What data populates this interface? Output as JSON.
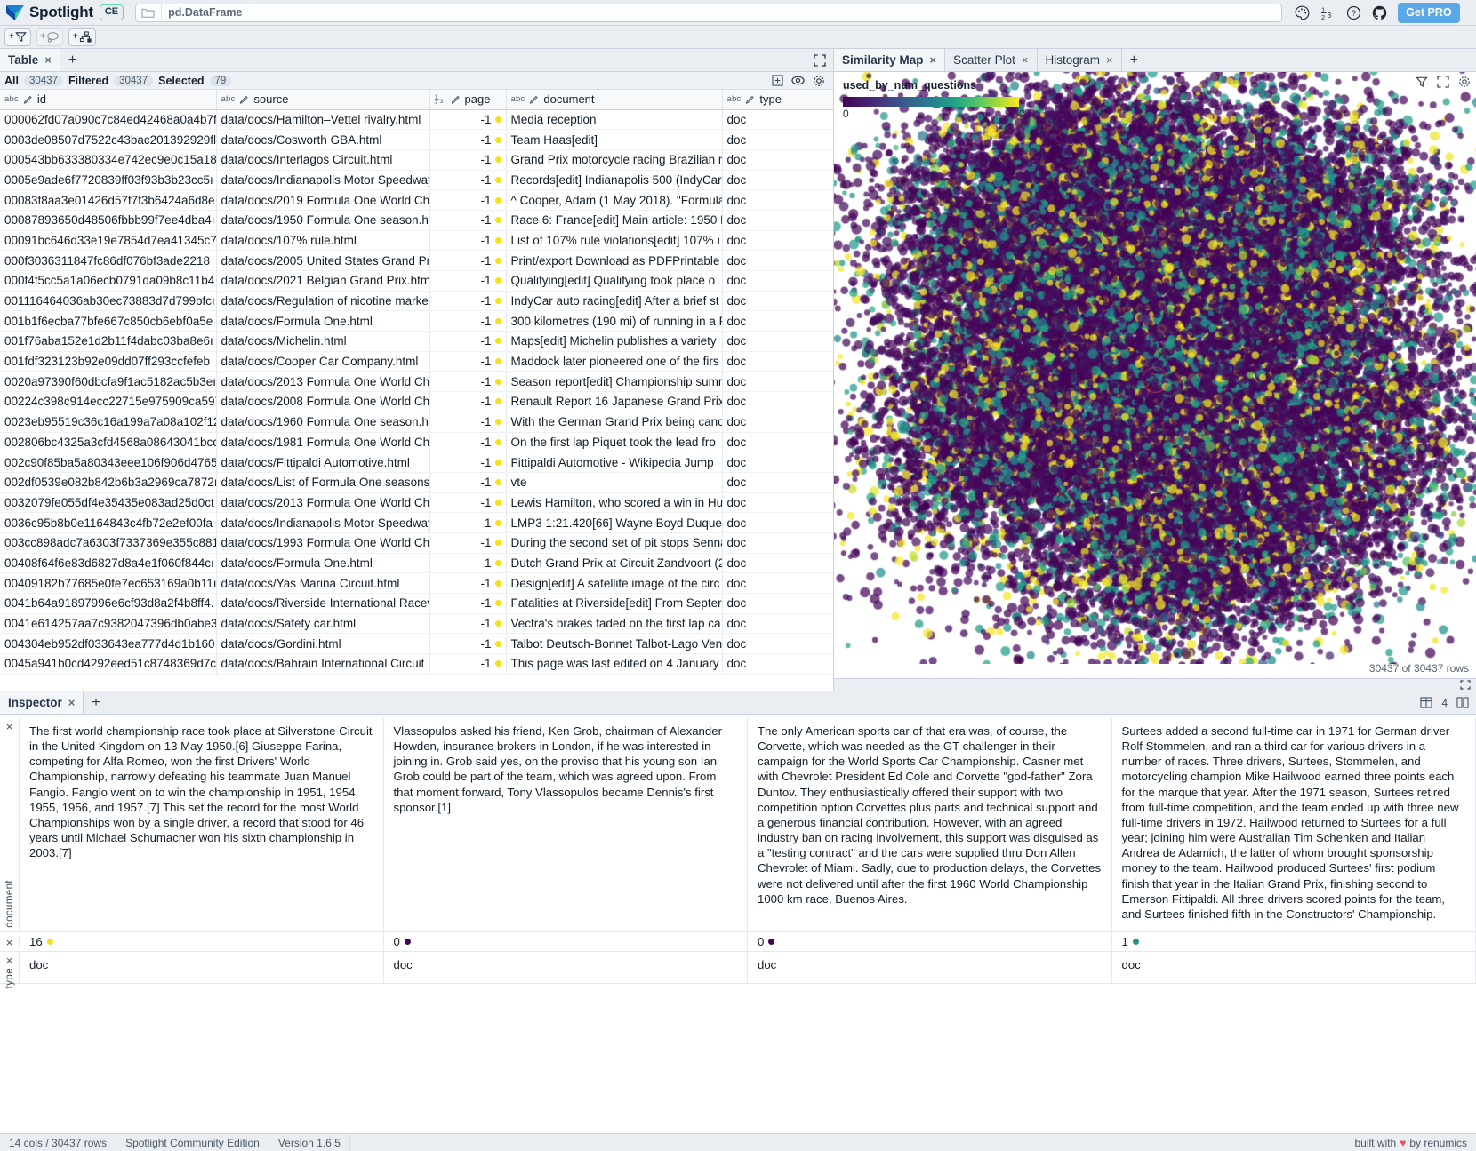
{
  "app": {
    "brand": "Spotlight",
    "edition_badge": "CE",
    "dataframe_label": "pd.DataFrame",
    "get_pro_label": "Get PRO",
    "icons": {
      "folder": "folder-icon",
      "palette": "palette-icon",
      "fraction": "number-format-icon",
      "help": "help-circle-icon",
      "github": "github-icon"
    }
  },
  "toolrow": {
    "add_filter_label": "+",
    "add_filter_icon": "funnel-icon",
    "add_group_icon": "lasso-icon",
    "add_issues_icon": "data-issues-icon"
  },
  "table_panel": {
    "tab_label": "Table",
    "tab_close": "×",
    "tab_add": "+",
    "maximize_icon": "maximize-icon",
    "counts": [
      {
        "label": "All",
        "value": "30437"
      },
      {
        "label": "Filtered",
        "value": "30437"
      },
      {
        "label": "Selected",
        "value": "79"
      }
    ],
    "right_icons": [
      "add-column-icon",
      "visibility-icon",
      "settings-icon"
    ],
    "columns": [
      {
        "name": "id",
        "type": "abc"
      },
      {
        "name": "source",
        "type": "abc"
      },
      {
        "name": "page",
        "type": "123"
      },
      {
        "name": "document",
        "type": "abc"
      },
      {
        "name": "type",
        "type": "abc"
      }
    ],
    "rows": [
      {
        "id": "000062fd07a090c7c84ed42468a0a4b7f",
        "source": "data/docs/Hamilton–Vettel rivalry.html",
        "page": "-1",
        "page_color": "#f5e119",
        "document": "Media reception",
        "type": "doc"
      },
      {
        "id": "0003de08507d7522c43bac201392929fl",
        "source": "data/docs/Cosworth GBA.html",
        "page": "-1",
        "page_color": "#f5e119",
        "document": "Team Haas[edit]",
        "type": "doc"
      },
      {
        "id": "000543bb633380334e742ec9e0c15a18",
        "source": "data/docs/Interlagos Circuit.html",
        "page": "-1",
        "page_color": "#f5e119",
        "document": "Grand Prix motorcycle racing Brazilian m",
        "type": "doc"
      },
      {
        "id": "0005e9ade6f7720839ff03f93b3b23cc5ı",
        "source": "data/docs/Indianapolis Motor Speedway",
        "page": "-1",
        "page_color": "#f5e119",
        "document": "Records[edit] Indianapolis 500 (IndyCar",
        "type": "doc"
      },
      {
        "id": "00083f8aa3e01426d57f7f3b6424a6d8e",
        "source": "data/docs/2019 Formula One World Cha",
        "page": "-1",
        "page_color": "#f5e119",
        "document": "^ Cooper, Adam (1 May 2018). \"Formula",
        "type": "doc"
      },
      {
        "id": "00087893650d48506fbbb99f7ee4dba4ı",
        "source": "data/docs/1950 Formula One season.ht",
        "page": "-1",
        "page_color": "#f5e119",
        "document": "Race 6: France[edit] Main article: 1950 F",
        "type": "doc"
      },
      {
        "id": "00091bc646d33e19e7854d7ea41345c7",
        "source": "data/docs/107% rule.html",
        "page": "-1",
        "page_color": "#f5e119",
        "document": "List of 107% rule violations[edit] 107% ı",
        "type": "doc"
      },
      {
        "id": "000f3036311847fc86df076bf3ade2218",
        "source": "data/docs/2005 United States Grand Pri",
        "page": "-1",
        "page_color": "#f5e119",
        "document": "Print/export Download as PDFPrintable",
        "type": "doc"
      },
      {
        "id": "000f4f5cc5a1a06ecb0791da09b8c11b4",
        "source": "data/docs/2021 Belgian Grand Prix.html",
        "page": "-1",
        "page_color": "#f5e119",
        "document": "Qualifying[edit] Qualifying took place o",
        "type": "doc"
      },
      {
        "id": "001116464036ab30ec73883d7d799bfcı",
        "source": "data/docs/Regulation of nicotine marke",
        "page": "-1",
        "page_color": "#f5e119",
        "document": "IndyCar auto racing[edit] After a brief st",
        "type": "doc"
      },
      {
        "id": "001b1f6ecba77bfe667c850cb6ebf0a5e",
        "source": "data/docs/Formula One.html",
        "page": "-1",
        "page_color": "#f5e119",
        "document": "300 kilometres (190 mi) of running in a F",
        "type": "doc"
      },
      {
        "id": "001f76aba152e1d2b11f4dabc03ba8e6ı",
        "source": "data/docs/Michelin.html",
        "page": "-1",
        "page_color": "#f5e119",
        "document": "Maps[edit] Michelin publishes a variety",
        "type": "doc"
      },
      {
        "id": "001fdf323123b92e09dd07ff293ccfefeb",
        "source": "data/docs/Cooper Car Company.html",
        "page": "-1",
        "page_color": "#f5e119",
        "document": "Maddock later pioneered one of the firs",
        "type": "doc"
      },
      {
        "id": "0020a97390f60dbcfa9f1ac5182ac5b3eı",
        "source": "data/docs/2013 Formula One World Cha",
        "page": "-1",
        "page_color": "#f5e119",
        "document": "Season report[edit] Championship sumr",
        "type": "doc"
      },
      {
        "id": "00224c398c914ecc22715e975909ca597",
        "source": "data/docs/2008 Formula One World Cha",
        "page": "-1",
        "page_color": "#f5e119",
        "document": "Renault Report 16 Japanese Grand Prix",
        "type": "doc"
      },
      {
        "id": "0023eb95519c36c16a199a7a08a102f12",
        "source": "data/docs/1960 Formula One season.ht",
        "page": "-1",
        "page_color": "#f5e119",
        "document": "With the German Grand Prix being cance",
        "type": "doc"
      },
      {
        "id": "002806bc4325a3cfd4568a08643041bcc",
        "source": "data/docs/1981 Formula One World Cha",
        "page": "-1",
        "page_color": "#f5e119",
        "document": "On the first lap Piquet took the lead fro",
        "type": "doc"
      },
      {
        "id": "002c90f85ba5a80343eee106f906d4765",
        "source": "data/docs/Fittipaldi Automotive.html",
        "page": "-1",
        "page_color": "#f5e119",
        "document": "Fittipaldi Automotive - Wikipedia Jump",
        "type": "doc"
      },
      {
        "id": "002df0539e082b842b6b3a2969ca7872ı",
        "source": "data/docs/List of Formula One seasons.",
        "page": "-1",
        "page_color": "#f5e119",
        "document": "vte",
        "type": "doc"
      },
      {
        "id": "0032079fe055df4e35435e083ad25d0ct",
        "source": "data/docs/2013 Formula One World Cha",
        "page": "-1",
        "page_color": "#f5e119",
        "document": "Lewis Hamilton, who scored a win in Hu",
        "type": "doc"
      },
      {
        "id": "0036c95b8b0e1164843c4fb72e2ef00fa",
        "source": "data/docs/Indianapolis Motor Speedway",
        "page": "-1",
        "page_color": "#f5e119",
        "document": "LMP3 1:21.420[66] Wayne Boyd Duquei",
        "type": "doc"
      },
      {
        "id": "003cc898adc7a6303f7337369e355c881",
        "source": "data/docs/1993 Formula One World Cha",
        "page": "-1",
        "page_color": "#f5e119",
        "document": "During the second set of pit stops Senna",
        "type": "doc"
      },
      {
        "id": "00408f64f6e83d6827d8a4e1f060f844cı",
        "source": "data/docs/Formula One.html",
        "page": "-1",
        "page_color": "#f5e119",
        "document": "Dutch Grand Prix at Circuit Zandvoort (2",
        "type": "doc"
      },
      {
        "id": "00409182b77685e0fe7ec653169a0b11ı",
        "source": "data/docs/Yas Marina Circuit.html",
        "page": "-1",
        "page_color": "#f5e119",
        "document": "Design[edit] A satellite image of the circ",
        "type": "doc"
      },
      {
        "id": "0041b64a91897996e6cf93d8a2f4b8ff4.",
        "source": "data/docs/Riverside International Racev",
        "page": "-1",
        "page_color": "#f5e119",
        "document": "Fatalities at Riverside[edit] From Septer",
        "type": "doc"
      },
      {
        "id": "0041e614257aa7c9382047396db0abe3",
        "source": "data/docs/Safety car.html",
        "page": "-1",
        "page_color": "#f5e119",
        "document": "Vectra's brakes faded on the first lap ca",
        "type": "doc"
      },
      {
        "id": "004304eb952df033643ea777d4d1b160",
        "source": "data/docs/Gordini.html",
        "page": "-1",
        "page_color": "#f5e119",
        "document": "Talbot Deutsch-Bonnet Talbot-Lago Ven",
        "type": "doc"
      },
      {
        "id": "0045a941b0cd4292eed51c8748369d7c",
        "source": "data/docs/Bahrain International Circuit",
        "page": "-1",
        "page_color": "#f5e119",
        "document": "This page was last edited on 4 January 2",
        "type": "doc"
      }
    ]
  },
  "plot_panel": {
    "tabs": [
      {
        "label": "Similarity Map",
        "active": true
      },
      {
        "label": "Scatter Plot",
        "active": false
      },
      {
        "label": "Histogram",
        "active": false
      }
    ],
    "tab_close": "×",
    "tab_add": "+",
    "maximize_icon": "maximize-icon",
    "toolbar_icons": [
      "filter-icon",
      "fullscreen-icon",
      "settings-icon"
    ],
    "row_count_label": "30437 of 30437 rows",
    "expand_icon": "expand-icon"
  },
  "chart_data": {
    "type": "scatter",
    "title": "used_by_num_questions",
    "colormap": "viridis",
    "colorbar": {
      "min": "0",
      "max": "2",
      "min_value": 0,
      "max_value": 2
    },
    "points_total": 30437,
    "points_shown": 30437,
    "xlabel": "",
    "ylabel": "",
    "grid": false,
    "legend_position": "top-left"
  },
  "inspector": {
    "tab_label": "Inspector",
    "tab_close": "×",
    "tab_add": "+",
    "columns_count": "4",
    "layout_icon": "grid-layout-icon",
    "columns_icon": "columns-icon",
    "rows": [
      {
        "field": "document",
        "close": "×",
        "cells": [
          "The first world championship race took place at Silverstone Circuit in the United Kingdom on 13 May 1950.[6] Giuseppe Farina, competing for Alfa Romeo, won the first Drivers' World Championship, narrowly defeating his teammate Juan Manuel Fangio. Fangio went on to win the championship in 1951, 1954, 1955, 1956, and 1957.[7] This set the record for the most World Championships won by a single driver, a record that stood for 46 years until Michael Schumacher won his sixth championship in 2003.[7]",
          "Vlassopulos asked his friend, Ken Grob, chairman of Alexander Howden, insurance brokers in London, if he was interested in joining in. Grob said yes, on the proviso that his young son Ian Grob could be part of the team, which was agreed upon. From that moment forward, Tony Vlassopulos became Dennis's first sponsor.[1]",
          "The only American sports car of that era was, of course, the Corvette, which was needed as the GT challenger in their campaign for the World Sports Car Championship. Casner met with Chevrolet President Ed Cole and Corvette \"god-father\" Zora Duntov. They enthusiastically offered their support with two competition option Corvettes plus parts and technical support and a generous financial contribution. However, with an agreed industry ban on racing involvement, this support was disguised as a \"testing contract\" and the cars were supplied thru Don Allen Chevrolet of Miami. Sadly, due to production delays, the Corvettes were not delivered until after the first 1960 World Championship 1000 km race, Buenos Aires.",
          "Surtees added a second full-time car in 1971 for German driver Rolf Stommelen, and ran a third car for various drivers in a number of races. Three drivers, Surtees, Stommelen, and motorcycling champion Mike Hailwood earned three points each for the marque that year.\nAfter the 1971 season, Surtees retired from full-time competition, and the team ended up with three new full-time drivers in 1972. Hailwood returned to Surtees for a full year; joining him were Australian Tim Schenken and Italian Andrea de Adamich, the latter of whom brought sponsorship money to the team. Hailwood produced Surtees' first podium finish that year in the Italian Grand Prix, finishing second to Emerson Fittipaldi. All three drivers scored points for the team, and Surtees finished fifth in the Constructors' Championship."
        ]
      },
      {
        "field": "",
        "close": "×",
        "cells": [
          "16",
          "0",
          "0",
          "1"
        ],
        "colors": [
          "#f5e119",
          "#440154",
          "#440154",
          "#21918c"
        ]
      },
      {
        "field": "type",
        "close": "×",
        "cells": [
          "doc",
          "doc",
          "doc",
          "doc"
        ]
      }
    ]
  },
  "statusbar": {
    "cols_rows": "14 cols / 30437 rows",
    "edition": "Spotlight Community Edition",
    "version": "Version 1.6.5",
    "built_prefix": "built with",
    "heart": "♥",
    "built_suffix": "by renumics"
  }
}
